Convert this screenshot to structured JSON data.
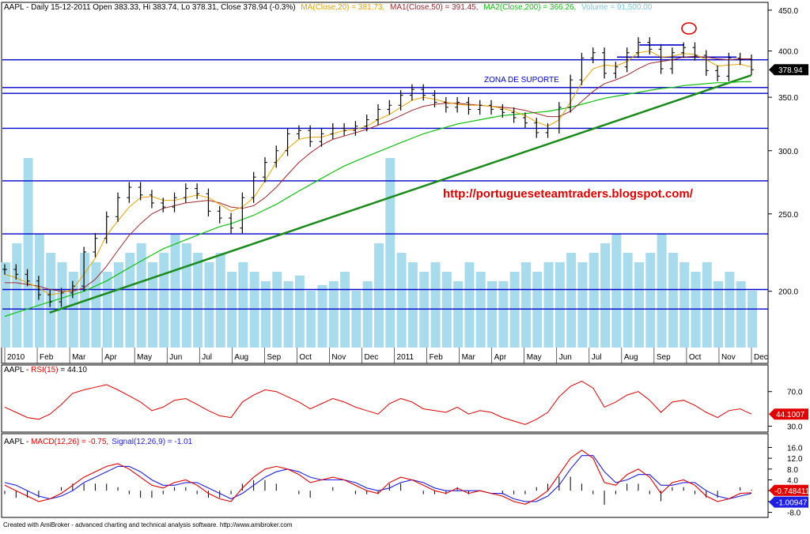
{
  "header": {
    "symbol_line": "AAPL - Daily 15-12-2011 Open 383.33, Hi 383.74, Lo 378.31, Close 378.94 (-0.3%)",
    "ma20": "MA(Close,20) = 381.73,",
    "ma50": "MA1(Close,50) = 391.45,",
    "ma200": "MA2(Close,200) = 366.26,",
    "volume": "Volume = 91,500.00"
  },
  "footer": "Created with AmiBroker - advanced charting and technical analysis software. http://www.amibroker.com",
  "annotations": {
    "url": "http://portugueseteamtraders.blogspot.com/",
    "support_zone": "ZONA DE SUPORTE"
  },
  "colors": {
    "price": "#000000",
    "ma20": "#e8a300",
    "ma50": "#a0282c",
    "ma200": "#10c010",
    "volume": "#a8dcec",
    "hline": "#0000cc",
    "trend": "#1a8a1a",
    "rsi": "#e00000",
    "macd": "#e00000",
    "signal": "#2020e0",
    "url_text": "#e00000"
  },
  "chart_data": [
    {
      "type": "line",
      "panel": "price",
      "title": "AAPL - Daily",
      "ylim": [
        170,
        455
      ],
      "log_scale": true,
      "y_ticks": [
        "450.0",
        "400.0",
        "350.0",
        "300.0",
        "250.0",
        "200.0"
      ],
      "y_tick_values": [
        450,
        400,
        350,
        300,
        250,
        200
      ],
      "x_month_labels": [
        "2010",
        "Feb",
        "Mar",
        "Apr",
        "May",
        "Jun",
        "Jul",
        "Aug",
        "Sep",
        "Oct",
        "Nov",
        "Dec",
        "2011",
        "Feb",
        "Mar",
        "Apr",
        "May",
        "Jun",
        "Jul",
        "Aug",
        "Sep",
        "Oct",
        "Nov",
        "Dec"
      ],
      "last_value_label": "378.94",
      "close": [
        213,
        210,
        206,
        198,
        194,
        199,
        203,
        224,
        233,
        248,
        262,
        270,
        264,
        258,
        255,
        262,
        269,
        265,
        252,
        247,
        240,
        262,
        278,
        290,
        300,
        315,
        318,
        308,
        315,
        320,
        318,
        322,
        328,
        338,
        342,
        352,
        358,
        352,
        345,
        340,
        345,
        338,
        342,
        338,
        335,
        330,
        325,
        316,
        320,
        340,
        368,
        392,
        398,
        375,
        382,
        398,
        410,
        402,
        380,
        398,
        404,
        395,
        378,
        372,
        392,
        390,
        379
      ],
      "ma20": [
        210,
        208,
        205,
        202,
        198,
        199,
        201,
        210,
        220,
        235,
        245,
        255,
        262,
        263,
        260,
        260,
        262,
        264,
        262,
        257,
        252,
        255,
        262,
        275,
        290,
        302,
        310,
        312,
        312,
        315,
        318,
        319,
        322,
        328,
        333,
        340,
        347,
        350,
        348,
        345,
        343,
        342,
        342,
        341,
        339,
        336,
        332,
        326,
        322,
        328,
        345,
        365,
        380,
        384,
        383,
        388,
        398,
        400,
        393,
        394,
        397,
        396,
        390,
        383,
        384,
        385,
        382
      ],
      "ma50": [
        205,
        205,
        204,
        203,
        201,
        200,
        200,
        202,
        207,
        215,
        225,
        235,
        243,
        250,
        254,
        256,
        258,
        259,
        260,
        258,
        255,
        254,
        256,
        262,
        270,
        280,
        290,
        298,
        305,
        310,
        313,
        316,
        319,
        323,
        327,
        332,
        337,
        341,
        343,
        344,
        344,
        343,
        342,
        341,
        340,
        339,
        337,
        334,
        331,
        331,
        336,
        346,
        356,
        364,
        368,
        373,
        380,
        386,
        388,
        390,
        393,
        394,
        393,
        391,
        390,
        391,
        391
      ],
      "ma200": [
        186,
        188,
        190,
        192,
        194,
        196,
        198,
        200,
        203,
        206,
        210,
        214,
        218,
        222,
        226,
        229,
        232,
        235,
        238,
        241,
        243,
        246,
        249,
        253,
        257,
        262,
        267,
        272,
        277,
        282,
        287,
        291,
        295,
        299,
        303,
        307,
        311,
        315,
        318,
        321,
        324,
        326,
        328,
        330,
        332,
        333,
        334,
        335,
        336,
        338,
        340,
        343,
        346,
        349,
        351,
        353,
        355,
        357,
        359,
        360,
        362,
        363,
        364,
        365,
        365,
        366,
        366
      ],
      "volume_relative": [
        0.45,
        0.55,
        1.0,
        0.6,
        0.5,
        0.45,
        0.4,
        0.5,
        0.45,
        0.4,
        0.45,
        0.5,
        0.55,
        0.45,
        0.5,
        0.6,
        0.55,
        0.5,
        0.45,
        0.5,
        0.4,
        0.45,
        0.4,
        0.35,
        0.4,
        0.35,
        0.38,
        0.3,
        0.33,
        0.35,
        0.4,
        0.3,
        0.35,
        0.55,
        1.0,
        0.5,
        0.45,
        0.4,
        0.45,
        0.4,
        0.35,
        0.45,
        0.4,
        0.35,
        0.35,
        0.4,
        0.45,
        0.4,
        0.45,
        0.45,
        0.5,
        0.45,
        0.5,
        0.55,
        0.6,
        0.5,
        0.45,
        0.5,
        0.6,
        0.5,
        0.45,
        0.4,
        0.45,
        0.35,
        0.4,
        0.35,
        0.3
      ]
    },
    {
      "type": "line",
      "panel": "rsi",
      "title": "AAPL - RSI(15) = 44.10",
      "title_prefix": "AAPL - ",
      "title_name": "RSI(15)",
      "title_value": " = 44.10",
      "ylim": [
        25,
        88
      ],
      "y_ticks": [
        "70.0",
        "30.0"
      ],
      "y_tick_values": [
        70,
        30
      ],
      "last_value_label": "44.1007",
      "values": [
        52,
        46,
        40,
        38,
        44,
        55,
        68,
        72,
        75,
        78,
        72,
        65,
        58,
        48,
        52,
        60,
        62,
        55,
        48,
        42,
        40,
        58,
        66,
        72,
        70,
        64,
        58,
        50,
        56,
        62,
        58,
        52,
        48,
        44,
        56,
        62,
        58,
        50,
        48,
        46,
        52,
        44,
        48,
        46,
        40,
        36,
        32,
        38,
        46,
        64,
        76,
        82,
        74,
        52,
        58,
        66,
        70,
        60,
        46,
        58,
        60,
        54,
        46,
        40,
        48,
        50,
        44
      ]
    },
    {
      "type": "line",
      "panel": "macd",
      "title": "AAPL - MACD(12,26) = -0.75, Signal(12,26,9) = -1.01",
      "title_prefix": "AAPL - ",
      "macd_title": "MACD(12,26) = -0.75,",
      "signal_title": "Signal(12,26,9) = -1.01",
      "ylim": [
        -9,
        17
      ],
      "y_ticks": [
        "16.0",
        "12.0",
        "8.0",
        "4.0",
        "0.0",
        "-4.0",
        "-8.0"
      ],
      "y_tick_values": [
        16,
        12,
        8,
        4,
        0,
        -4,
        -8
      ],
      "macd_last_label": "-0.748411",
      "signal_last_label": "-1.00947",
      "macd": [
        2,
        0,
        -2,
        -4,
        -3,
        -1,
        2,
        5,
        7,
        9,
        10,
        8,
        5,
        2,
        1,
        3,
        4,
        2,
        -1,
        -3,
        -4,
        1,
        5,
        8,
        9,
        8,
        6,
        3,
        4,
        5,
        4,
        2,
        0,
        -1,
        3,
        5,
        4,
        2,
        0,
        -1,
        1,
        -1,
        0,
        -1,
        -2,
        -4,
        -5,
        -3,
        0,
        6,
        12,
        15,
        12,
        3,
        2,
        6,
        8,
        5,
        -1,
        3,
        4,
        2,
        -2,
        -4,
        -3,
        -1,
        -0.75
      ],
      "signal": [
        3,
        2,
        0,
        -2,
        -3,
        -2,
        0,
        3,
        5,
        7,
        9,
        9,
        7,
        4,
        2,
        2,
        3,
        3,
        1,
        -1,
        -3,
        -1,
        2,
        5,
        7,
        8,
        7,
        5,
        4,
        4,
        4,
        3,
        1,
        0,
        1,
        3,
        4,
        3,
        1,
        0,
        0,
        0,
        0,
        -1,
        -1,
        -3,
        -4,
        -4,
        -2,
        2,
        8,
        13,
        13,
        7,
        3,
        4,
        6,
        6,
        2,
        2,
        3,
        3,
        0,
        -2,
        -3,
        -2,
        -1.01
      ]
    }
  ],
  "horizontal_levels": [
    390,
    360,
    354,
    320,
    275,
    236,
    201,
    190
  ],
  "trendline": {
    "from": [
      0.06,
      188
    ],
    "to": [
      1.0,
      373
    ]
  },
  "marked_high": 418,
  "resistance_segments": [
    {
      "from": 0.85,
      "to": 0.91,
      "value": 407
    },
    {
      "from": 0.82,
      "to": 0.98,
      "value": 393
    }
  ]
}
